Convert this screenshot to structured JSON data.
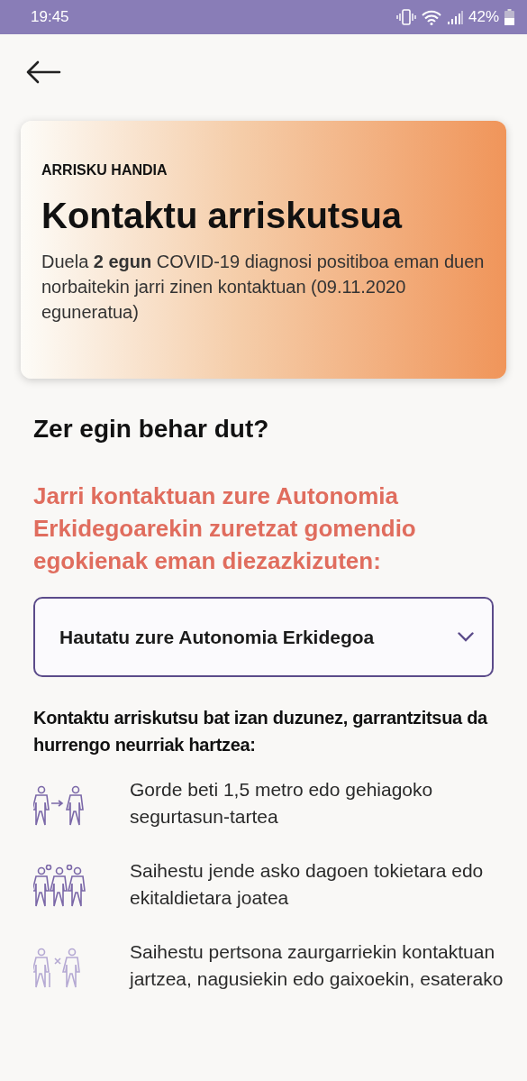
{
  "status_bar": {
    "time": "19:45",
    "battery": "42%"
  },
  "risk_card": {
    "level_label": "ARRISKU HANDIA",
    "title": "Kontaktu arriskutsua",
    "description": "Duela **2 egun** COVID-19 diagnosi positiboa eman duen norbaitekin jarri zinen kontaktuan (09.11.2020 eguneratua)"
  },
  "section_title": "Zer egin behar dut?",
  "advice": "Jarri kontaktuan zure Autonomia Erkidegoarekin zuretzat gomendio egokienak eman diezazkizuten:",
  "region_select": {
    "placeholder": "Hautatu zure Autonomia Erkidegoa"
  },
  "measures_intro": "Kontaktu arriskutsu bat izan duzunez, garrantzitsua da hurrengo neurriak hartzea:",
  "measures": [
    {
      "kind": "distance",
      "text": "Gorde beti 1,5 metro edo gehiagoko segurtasun-tartea"
    },
    {
      "kind": "crowd",
      "text": "Saihestu jende asko dagoen tokietara edo ekitaldietara joatea"
    },
    {
      "kind": "vulnerable",
      "text": "Saihestu pertsona zaurgarriekin kontaktuan jartzea, nagusiekin edo gaixoekin, esaterako"
    }
  ]
}
